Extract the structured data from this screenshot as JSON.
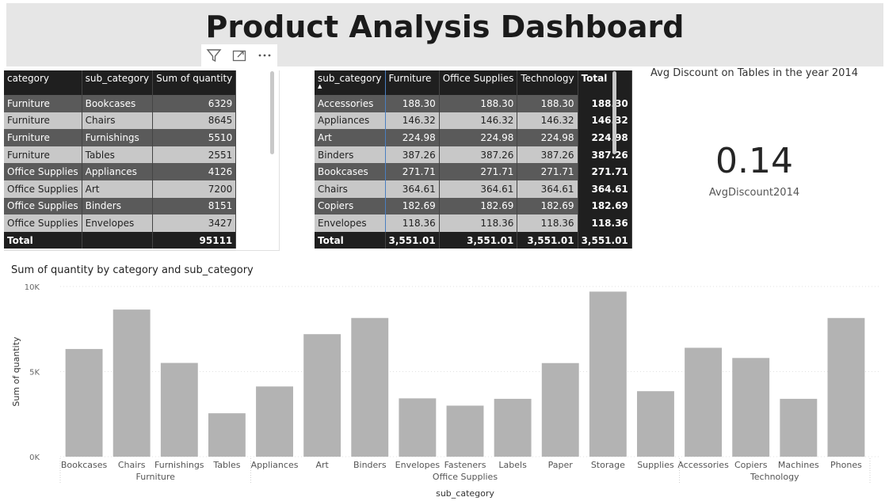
{
  "title": "Product Analysis Dashboard",
  "toolbar": [
    {
      "name": "filter-icon",
      "glyph": "⏷"
    },
    {
      "name": "focus-mode-icon",
      "glyph": "⤢"
    },
    {
      "name": "more-options-icon",
      "glyph": "⋯"
    }
  ],
  "table1": {
    "headers": [
      "category",
      "sub_category",
      "Sum of quantity"
    ],
    "rows": [
      [
        "Furniture",
        "Bookcases",
        "6329"
      ],
      [
        "Furniture",
        "Chairs",
        "8645"
      ],
      [
        "Furniture",
        "Furnishings",
        "5510"
      ],
      [
        "Furniture",
        "Tables",
        "2551"
      ],
      [
        "Office Supplies",
        "Appliances",
        "4126"
      ],
      [
        "Office Supplies",
        "Art",
        "7200"
      ],
      [
        "Office Supplies",
        "Binders",
        "8151"
      ],
      [
        "Office Supplies",
        "Envelopes",
        "3427"
      ]
    ],
    "total": [
      "Total",
      "",
      "95111"
    ]
  },
  "table2": {
    "headers": [
      "sub_category",
      "Furniture",
      "Office Supplies",
      "Technology",
      "Total"
    ],
    "sort_glyph": "▲",
    "rows": [
      [
        "Accessories",
        "188.30",
        "188.30",
        "188.30",
        "188.30"
      ],
      [
        "Appliances",
        "146.32",
        "146.32",
        "146.32",
        "146.32"
      ],
      [
        "Art",
        "224.98",
        "224.98",
        "224.98",
        "224.98"
      ],
      [
        "Binders",
        "387.26",
        "387.26",
        "387.26",
        "387.26"
      ],
      [
        "Bookcases",
        "271.71",
        "271.71",
        "271.71",
        "271.71"
      ],
      [
        "Chairs",
        "364.61",
        "364.61",
        "364.61",
        "364.61"
      ],
      [
        "Copiers",
        "182.69",
        "182.69",
        "182.69",
        "182.69"
      ],
      [
        "Envelopes",
        "118.36",
        "118.36",
        "118.36",
        "118.36"
      ]
    ],
    "total": [
      "Total",
      "3,551.01",
      "3,551.01",
      "3,551.01",
      "3,551.01"
    ]
  },
  "card": {
    "title": "Avg Discount on Tables in the year 2014",
    "value": "0.14",
    "label": "AvgDiscount2014"
  },
  "chart_data": {
    "type": "bar",
    "title": "Sum of quantity by category and sub_category",
    "xlabel": "sub_category",
    "ylabel": "Sum of quantity",
    "ylim": [
      0,
      10000
    ],
    "yticks": [
      0,
      5000,
      10000
    ],
    "ytick_labels": [
      "0K",
      "5K",
      "10K"
    ],
    "bar_color": "#b3b3b3",
    "groups": [
      {
        "name": "Furniture",
        "categories": [
          "Bookcases",
          "Chairs",
          "Furnishings",
          "Tables"
        ],
        "values": [
          6329,
          8645,
          5510,
          2551
        ]
      },
      {
        "name": "Office Supplies",
        "categories": [
          "Appliances",
          "Art",
          "Binders",
          "Envelopes",
          "Fasteners",
          "Labels",
          "Paper",
          "Storage",
          "Supplies"
        ],
        "values": [
          4126,
          7200,
          8151,
          3427,
          3000,
          3400,
          5500,
          9700,
          3850
        ]
      },
      {
        "name": "Technology",
        "categories": [
          "Accessories",
          "Copiers",
          "Machines",
          "Phones"
        ],
        "values": [
          6400,
          5800,
          3400,
          8150
        ]
      }
    ]
  }
}
